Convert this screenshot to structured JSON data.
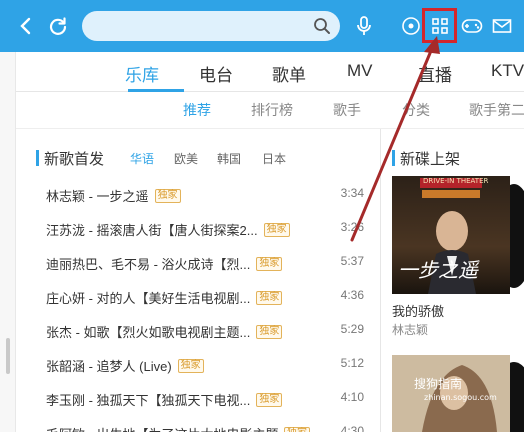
{
  "colors": {
    "accent": "#2fa3e6",
    "badge": "#d99a2b",
    "highlight": "#d4262b"
  },
  "topbar": {
    "icons": [
      "back-icon",
      "refresh-icon",
      "search-icon",
      "microphone-icon",
      "target-icon",
      "grid-icon",
      "gamepad-icon",
      "mail-icon"
    ]
  },
  "primary_tabs": [
    "乐库",
    "电台",
    "歌单",
    "MV",
    "直播",
    "KTV"
  ],
  "secondary_tabs": [
    "推荐",
    "排行榜",
    "歌手",
    "分类",
    "歌手第二"
  ],
  "new_songs": {
    "title": "新歌首发",
    "regions": [
      "华语",
      "欧美",
      "韩国",
      "日本"
    ],
    "songs": [
      {
        "title": "林志颖 - 一步之遥",
        "badge": "独家",
        "duration": "3:34"
      },
      {
        "title": "汪苏泷 - 摇滚唐人街【唐人街探案2...",
        "badge": "独家",
        "duration": "3:26"
      },
      {
        "title": "迪丽热巴、毛不易 - 浴火成诗【烈...",
        "badge": "独家",
        "duration": "5:37"
      },
      {
        "title": "庄心妍 - 对的人【美好生活电视剧...",
        "badge": "独家",
        "duration": "4:36"
      },
      {
        "title": "张杰 - 如歌【烈火如歌电视剧主题...",
        "badge": "独家",
        "duration": "5:29"
      },
      {
        "title": "张韶涵 - 追梦人 (Live)",
        "badge": "独家",
        "duration": "5:12"
      },
      {
        "title": "李玉刚 - 独孤天下【独孤天下电视...",
        "badge": "独家",
        "duration": "4:10"
      },
      {
        "title": "毛阿敏 - 出生地【为了这片大地电影主题...",
        "badge": "独家",
        "duration": "4:30"
      }
    ]
  },
  "new_albums": {
    "title": "新碟上架",
    "albums": [
      {
        "name": "我的骄傲",
        "artist": "林志颖",
        "cover_text": "一步之遥",
        "cover_top": "DRIVE-IN THEATER"
      },
      {
        "watermark": "搜狗指南",
        "watermark2": "zhinan.sogou.com"
      }
    ]
  }
}
